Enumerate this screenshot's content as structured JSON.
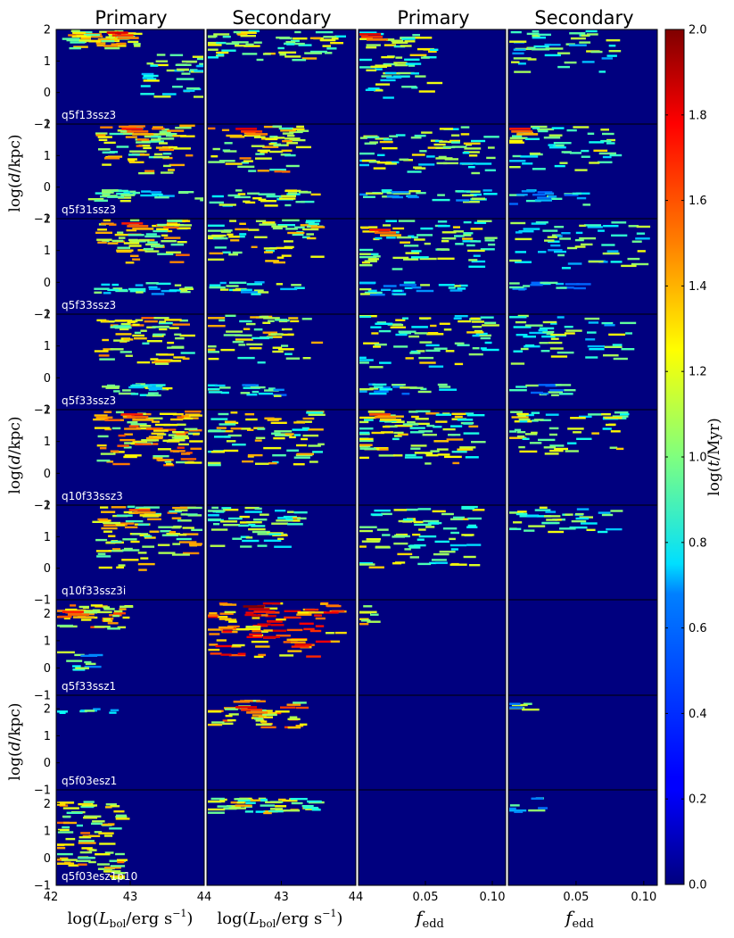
{
  "chart_data": {
    "type": "heatmap",
    "column_titles": [
      "Primary",
      "Secondary",
      "Primary",
      "Secondary"
    ],
    "panel_labels": [
      "q5f13ssz3",
      "q5f31ssz3",
      "q5f33ssz3",
      "q5f33ssz3",
      "q10f33ssz3",
      "q10f33ssz3i",
      "q5f33ssz1",
      "q5f03esz1",
      "q5f03esz1p10"
    ],
    "row_ylabels": [
      "log(d/kpc)",
      "log(d/kpc)",
      "log(d/kpc)"
    ],
    "xlabels": [
      "log(L_bol/erg s^-1)",
      "log(L_bol/erg s^-1)",
      "f_edd",
      "f_edd"
    ],
    "xlabel_parts": {
      "log_open": "log(",
      "L": "L",
      "L_sub": "bol",
      "unit": "/erg s",
      "exp": "−1",
      "close": ")",
      "f": "f",
      "f_sub": "edd"
    },
    "xticks": {
      "lum_left": [
        {
          "v": 42,
          "label": "42"
        },
        {
          "v": 43,
          "label": "43"
        },
        {
          "v": 44,
          "label": "44"
        }
      ],
      "lum_right": [
        {
          "v": 43,
          "label": "43"
        },
        {
          "v": 44,
          "label": "44"
        }
      ],
      "fedd": [
        {
          "v": 0.05,
          "label": "0.05"
        },
        {
          "v": 0.1,
          "label": "0.10"
        }
      ],
      "lum_range": [
        42,
        44
      ],
      "fedd_range": [
        0,
        0.11
      ]
    },
    "yticks": {
      "set_a": [
        {
          "v": 2,
          "label": "2"
        },
        {
          "v": 1,
          "label": "1"
        },
        {
          "v": 0,
          "label": "0"
        },
        {
          "v": -1,
          "label": "−1"
        }
      ],
      "set_b": [
        {
          "v": 2,
          "label": "2"
        },
        {
          "v": 1,
          "label": "1"
        },
        {
          "v": 0,
          "label": "0"
        },
        {
          "v": -1,
          "label": "−1"
        }
      ],
      "range_a": [
        -1,
        2
      ],
      "range_b": [
        -1,
        2.5
      ]
    },
    "colorbar": {
      "label": "log(t/Myr)",
      "label_parts": {
        "log_open": "log(",
        "t": "t",
        "unit": "/Myr)"
      },
      "range": [
        0,
        2
      ],
      "ticks": [
        {
          "v": 2.0,
          "label": "2.0"
        },
        {
          "v": 1.8,
          "label": "1.8"
        },
        {
          "v": 1.6,
          "label": "1.6"
        },
        {
          "v": 1.4,
          "label": "1.4"
        },
        {
          "v": 1.2,
          "label": "1.2"
        },
        {
          "v": 1.0,
          "label": "1.0"
        },
        {
          "v": 0.8,
          "label": "0.8"
        },
        {
          "v": 0.6,
          "label": "0.6"
        },
        {
          "v": 0.4,
          "label": "0.4"
        },
        {
          "v": 0.2,
          "label": "0.2"
        },
        {
          "v": 0.0,
          "label": "0.0"
        }
      ],
      "colormap": "jet"
    },
    "density": [
      {
        "panel": 0,
        "features": [
          {
            "col": 0,
            "x": [
              42.2,
              43.1
            ],
            "y": [
              1.4,
              1.95
            ],
            "v": 1.2,
            "n": 55
          },
          {
            "col": 0,
            "x": [
              43.2,
              44.0
            ],
            "y": [
              -0.2,
              1.2
            ],
            "v": 0.9,
            "n": 40
          },
          {
            "col": 1,
            "x": [
              42.0,
              43.8
            ],
            "y": [
              1.0,
              1.95
            ],
            "v": 1.1,
            "n": 60
          },
          {
            "col": 2,
            "x": [
              0.0,
              0.06
            ],
            "y": [
              -0.2,
              1.95
            ],
            "v": 1.0,
            "n": 60
          },
          {
            "col": 3,
            "x": [
              0.0,
              0.08
            ],
            "y": [
              0.6,
              1.95
            ],
            "v": 0.9,
            "n": 45
          }
        ]
      },
      {
        "panel": 1,
        "features": [
          {
            "col": 0,
            "x": [
              42.6,
              43.8
            ],
            "y": [
              0.4,
              1.95
            ],
            "v": 1.2,
            "n": 75
          },
          {
            "col": 0,
            "x": [
              42.5,
              44.0
            ],
            "y": [
              -0.5,
              -0.1
            ],
            "v": 0.9,
            "n": 30
          },
          {
            "col": 1,
            "x": [
              42.0,
              43.3
            ],
            "y": [
              0.4,
              1.95
            ],
            "v": 1.2,
            "n": 60
          },
          {
            "col": 1,
            "x": [
              42.1,
              43.5
            ],
            "y": [
              -0.6,
              -0.1
            ],
            "v": 1.0,
            "n": 30
          },
          {
            "col": 2,
            "x": [
              0.0,
              0.1
            ],
            "y": [
              0.3,
              1.95
            ],
            "v": 1.0,
            "n": 70
          },
          {
            "col": 2,
            "x": [
              0.0,
              0.1
            ],
            "y": [
              -0.5,
              -0.1
            ],
            "v": 0.8,
            "n": 30
          },
          {
            "col": 3,
            "x": [
              0.0,
              0.08
            ],
            "y": [
              0.4,
              1.95
            ],
            "v": 1.0,
            "n": 50
          },
          {
            "col": 3,
            "x": [
              0.0,
              0.06
            ],
            "y": [
              -0.6,
              -0.1
            ],
            "v": 0.7,
            "n": 20
          }
        ]
      },
      {
        "panel": 2,
        "features": [
          {
            "col": 0,
            "x": [
              42.6,
              43.8
            ],
            "y": [
              0.6,
              1.95
            ],
            "v": 1.2,
            "n": 70
          },
          {
            "col": 0,
            "x": [
              42.5,
              43.8
            ],
            "y": [
              -0.4,
              0.0
            ],
            "v": 0.8,
            "n": 25
          },
          {
            "col": 1,
            "x": [
              42.0,
              43.5
            ],
            "y": [
              0.6,
              1.95
            ],
            "v": 1.1,
            "n": 60
          },
          {
            "col": 1,
            "x": [
              42.1,
              43.3
            ],
            "y": [
              -0.4,
              0.0
            ],
            "v": 0.9,
            "n": 20
          },
          {
            "col": 2,
            "x": [
              0.0,
              0.1
            ],
            "y": [
              0.4,
              1.95
            ],
            "v": 1.0,
            "n": 70
          },
          {
            "col": 2,
            "x": [
              0.0,
              0.08
            ],
            "y": [
              -0.4,
              0.0
            ],
            "v": 0.8,
            "n": 25
          },
          {
            "col": 3,
            "x": [
              0.0,
              0.1
            ],
            "y": [
              0.4,
              1.95
            ],
            "v": 0.9,
            "n": 55
          },
          {
            "col": 3,
            "x": [
              0.0,
              0.06
            ],
            "y": [
              -0.4,
              0.0
            ],
            "v": 0.7,
            "n": 15
          }
        ]
      },
      {
        "panel": 3,
        "features": [
          {
            "col": 0,
            "x": [
              42.6,
              43.8
            ],
            "y": [
              0.4,
              1.95
            ],
            "v": 1.2,
            "n": 70
          },
          {
            "col": 0,
            "x": [
              42.6,
              43.6
            ],
            "y": [
              -0.6,
              -0.2
            ],
            "v": 0.9,
            "n": 25
          },
          {
            "col": 1,
            "x": [
              42.0,
              43.5
            ],
            "y": [
              0.4,
              1.95
            ],
            "v": 1.1,
            "n": 55
          },
          {
            "col": 1,
            "x": [
              42.0,
              43.0
            ],
            "y": [
              -0.6,
              -0.2
            ],
            "v": 0.8,
            "n": 20
          },
          {
            "col": 2,
            "x": [
              0.0,
              0.1
            ],
            "y": [
              0.3,
              1.95
            ],
            "v": 1.0,
            "n": 70
          },
          {
            "col": 2,
            "x": [
              0.0,
              0.07
            ],
            "y": [
              -0.6,
              -0.2
            ],
            "v": 0.8,
            "n": 20
          },
          {
            "col": 3,
            "x": [
              0.0,
              0.09
            ],
            "y": [
              0.4,
              1.95
            ],
            "v": 0.9,
            "n": 50
          },
          {
            "col": 3,
            "x": [
              0.0,
              0.05
            ],
            "y": [
              -0.6,
              -0.2
            ],
            "v": 0.7,
            "n": 15
          }
        ]
      },
      {
        "panel": 4,
        "features": [
          {
            "col": 0,
            "x": [
              42.6,
              43.9
            ],
            "y": [
              0.2,
              1.95
            ],
            "v": 1.3,
            "n": 110
          },
          {
            "col": 1,
            "x": [
              42.0,
              43.6
            ],
            "y": [
              0.2,
              1.95
            ],
            "v": 1.1,
            "n": 75
          },
          {
            "col": 2,
            "x": [
              0.0,
              0.09
            ],
            "y": [
              0.2,
              1.95
            ],
            "v": 1.1,
            "n": 90
          },
          {
            "col": 3,
            "x": [
              0.0,
              0.09
            ],
            "y": [
              0.6,
              1.95
            ],
            "v": 1.0,
            "n": 55
          }
        ]
      },
      {
        "panel": 5,
        "features": [
          {
            "col": 0,
            "x": [
              42.6,
              43.9
            ],
            "y": [
              -0.1,
              1.95
            ],
            "v": 1.2,
            "n": 95
          },
          {
            "col": 1,
            "x": [
              42.0,
              43.3
            ],
            "y": [
              0.6,
              1.95
            ],
            "v": 1.0,
            "n": 55
          },
          {
            "col": 2,
            "x": [
              0.0,
              0.09
            ],
            "y": [
              -0.1,
              1.95
            ],
            "v": 1.0,
            "n": 80
          },
          {
            "col": 3,
            "x": [
              0.0,
              0.08
            ],
            "y": [
              1.0,
              1.95
            ],
            "v": 0.9,
            "n": 40
          }
        ]
      },
      {
        "panel": 6,
        "features": [
          {
            "col": 0,
            "x": [
              42.0,
              43.0
            ],
            "y": [
              1.4,
              2.3
            ],
            "v": 1.3,
            "n": 45
          },
          {
            "col": 0,
            "x": [
              42.0,
              42.6
            ],
            "y": [
              -0.3,
              0.6
            ],
            "v": 0.8,
            "n": 12
          },
          {
            "col": 1,
            "x": [
              42.0,
              43.8
            ],
            "y": [
              0.3,
              2.4
            ],
            "v": 1.5,
            "n": 100
          },
          {
            "col": 2,
            "x": [
              0.0,
              0.012
            ],
            "y": [
              1.6,
              2.3
            ],
            "v": 1.2,
            "n": 8
          }
        ]
      },
      {
        "panel": 7,
        "features": [
          {
            "col": 0,
            "x": [
              42.0,
              42.9
            ],
            "y": [
              1.8,
              2.0
            ],
            "v": 0.9,
            "n": 8
          },
          {
            "col": 1,
            "x": [
              42.0,
              43.3
            ],
            "y": [
              1.2,
              2.3
            ],
            "v": 1.3,
            "n": 45
          },
          {
            "col": 3,
            "x": [
              0.0,
              0.025
            ],
            "y": [
              1.9,
              2.2
            ],
            "v": 0.8,
            "n": 6
          }
        ]
      },
      {
        "panel": 8,
        "features": [
          {
            "col": 0,
            "x": [
              42.0,
              42.9
            ],
            "y": [
              -0.8,
              2.1
            ],
            "v": 1.2,
            "n": 85
          },
          {
            "col": 1,
            "x": [
              42.0,
              43.5
            ],
            "y": [
              1.6,
              2.2
            ],
            "v": 1.1,
            "n": 50
          },
          {
            "col": 3,
            "x": [
              0.0,
              0.03
            ],
            "y": [
              1.6,
              2.2
            ],
            "v": 0.8,
            "n": 8
          }
        ]
      }
    ],
    "hotspots": [
      {
        "panel": 0,
        "col": 0,
        "x": 42.9,
        "y": 1.85,
        "v": 1.8
      },
      {
        "panel": 0,
        "col": 2,
        "x": 0.01,
        "y": 1.8,
        "v": 1.8
      },
      {
        "panel": 1,
        "col": 0,
        "x": 43.1,
        "y": 1.8,
        "v": 1.7
      },
      {
        "panel": 1,
        "col": 1,
        "x": 42.6,
        "y": 1.8,
        "v": 1.8
      },
      {
        "panel": 1,
        "col": 3,
        "x": 0.01,
        "y": 1.8,
        "v": 1.7
      },
      {
        "panel": 2,
        "col": 0,
        "x": 43.1,
        "y": 1.8,
        "v": 1.7
      },
      {
        "panel": 2,
        "col": 2,
        "x": 0.02,
        "y": 1.6,
        "v": 1.7
      },
      {
        "panel": 4,
        "col": 0,
        "x": 43.1,
        "y": 1.8,
        "v": 1.7
      },
      {
        "panel": 4,
        "col": 2,
        "x": 0.02,
        "y": 1.8,
        "v": 1.6
      },
      {
        "panel": 5,
        "col": 0,
        "x": 43.2,
        "y": 1.8,
        "v": 1.6
      },
      {
        "panel": 6,
        "col": 1,
        "x": 42.7,
        "y": 2.2,
        "v": 2.0
      },
      {
        "panel": 6,
        "col": 0,
        "x": 42.3,
        "y": 2.0,
        "v": 1.7
      },
      {
        "panel": 7,
        "col": 1,
        "x": 42.6,
        "y": 2.0,
        "v": 1.8
      }
    ]
  }
}
